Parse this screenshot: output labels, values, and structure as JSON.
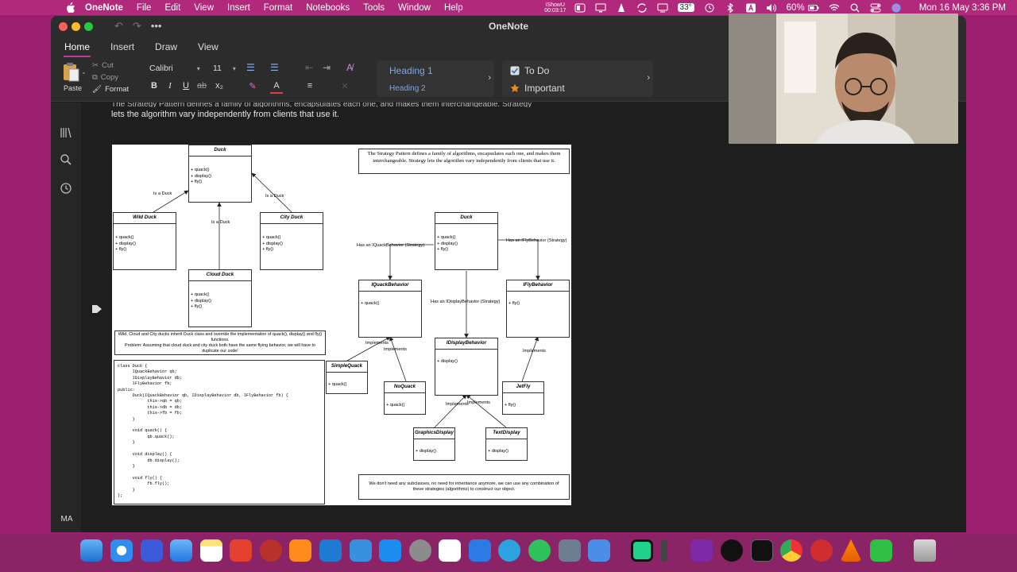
{
  "menubar": {
    "app_name": "OneNote",
    "items": [
      "File",
      "Edit",
      "View",
      "Insert",
      "Format",
      "Notebooks",
      "Tools",
      "Window",
      "Help"
    ],
    "ishowu_label": "iShowU",
    "ishowu_time": "00:03:17",
    "temperature": "33°",
    "battery": "60%",
    "datetime": "Mon 16 May  3:36 PM"
  },
  "window": {
    "title": "OneNote",
    "tabs": [
      "Home",
      "Insert",
      "Draw",
      "View"
    ],
    "active_tab": "Home"
  },
  "ribbon": {
    "paste": "Paste",
    "cut": "Cut",
    "copy": "Copy",
    "format": "Format",
    "font": "Calibri",
    "size": "11",
    "heading1": "Heading 1",
    "heading2": "Heading 2",
    "tag_todo": "To Do",
    "tag_important": "Important"
  },
  "sidebar": {
    "avatar": "MA"
  },
  "note": {
    "line1_cut": "The Strategy Pattern defines a family of algorithms, encapsulates each one, and makes them interchangeable. Strategy",
    "line2": "lets the algorithm vary independently from clients that use it."
  },
  "diagram": {
    "left": {
      "duck": {
        "name": "Duck",
        "methods": [
          "+ quack()",
          "+ display()",
          "+ fly()"
        ]
      },
      "wild": {
        "name": "Wild Duck",
        "methods": [
          "+ quack()",
          "+ display()",
          "+ fly()"
        ]
      },
      "city": {
        "name": "City Duck",
        "methods": [
          "+ quack()",
          "+ display()",
          "+ fly()"
        ]
      },
      "cloud": {
        "name": "Cloud Duck",
        "methods": [
          "+ quack()",
          "+ display()",
          "+ fly()"
        ]
      },
      "is_a_duck": "Is a Duck",
      "note": "Wild, Cloud and City ducks inherit Duck class and override the implementation of quack(), display() and fly() functions.",
      "problem": "Problem: Assuming that cloud duck and city duck both have the same flying behavior, we will have to duplicate our code!"
    },
    "code": "class Duck {\n      IQuackBehavior qb;\n      IDisplayBehavior db;\n      IFlyBehavior fb;\npublic:\n      Duck(IQuackBehavior qb, IDisplayBehavior db, IFlyBehavior fb) {\n            this->qb = qb;\n            this->db = db;\n            this->fb = fb;\n      }\n\n      void quack() {\n            qb.quack();\n      }\n\n      void display() {\n            db.display();\n      }\n\n      void fly() {\n            fb.fly();\n      }\n};",
    "right": {
      "definition": "The Strategy Pattern defines a family of algorithms, encapsulates each one, and makes them interchangeable. Strategy lets the algorithm vary independently from clients that use it.",
      "duck": {
        "name": "Duck",
        "methods": [
          "+ quack()",
          "+ display()",
          "+ fly()"
        ]
      },
      "iquack": {
        "name": "IQuackBehavior",
        "methods": [
          "+ quack()"
        ]
      },
      "idisplay": {
        "name": "IDisplayBehavior",
        "methods": [
          "+ display()"
        ]
      },
      "ifly": {
        "name": "IFlyBehavior",
        "methods": [
          "+ fly()"
        ]
      },
      "simplequack": {
        "name": "SimpleQuack",
        "methods": [
          "+ quack()"
        ]
      },
      "noquack": {
        "name": "NoQuack",
        "methods": [
          "+ quack()"
        ]
      },
      "jetfly": {
        "name": "JetFly",
        "methods": [
          "+ fly()"
        ]
      },
      "graphics": {
        "name": "GraphicsDisplay",
        "methods": [
          "+ display()"
        ]
      },
      "textdisplay": {
        "name": "TextDisplay",
        "methods": [
          "+ display()"
        ]
      },
      "has_quack": "Has an IQuackBehavior (Strategy)",
      "has_fly": "Has an IFlyBehavior (Strategy)",
      "has_display": "Has an IDisplayBehavior (Strategy)",
      "implements": "Implements",
      "footer": "We don't need any subclasses, no need for inheritance anymore, we can use any combination of these strategies (algorithms) to construct our object."
    }
  },
  "colors": {
    "desktop": "#9b1f6e",
    "accent": "#bf3b9b",
    "heading": "#7ea8e6",
    "important_star": "#f08c1d"
  }
}
